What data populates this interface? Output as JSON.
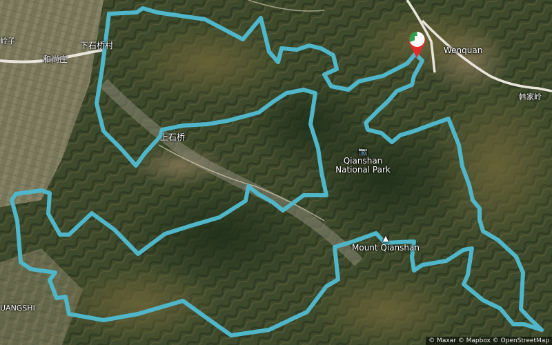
{
  "map": {
    "route_color": "#4fb7c9",
    "start_marker_colors": [
      "#2e9e4a",
      "#ffffff",
      "#e32b2b"
    ],
    "labels": {
      "ling_zi": "岭子",
      "xia_shiqiao_cun": "下石桥村",
      "he_shang_zhuang": "和尚庄",
      "shang_shiqiao": "上石桥",
      "wenquan": "Wenquan",
      "han_jia_ling": "韩家岭",
      "qianshan_np": "Qianshan National Park",
      "mount_qianshan": "Mount Qianshan",
      "uangshi": "UANGSHI"
    },
    "icons": {
      "park": "camera-icon",
      "peak": "mountain-peak-icon"
    },
    "attribution": [
      "© Maxar",
      "© Mapbox",
      "© OpenStreetMap"
    ]
  }
}
